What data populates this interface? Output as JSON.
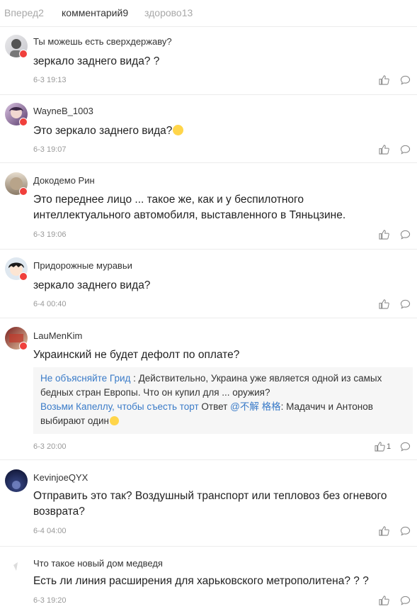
{
  "tabs": [
    {
      "label": "Вперед",
      "count": "2"
    },
    {
      "label": "комментарий",
      "count": "9"
    },
    {
      "label": "здорово",
      "count": "13"
    }
  ],
  "comments": [
    {
      "username": "Ты можешь есть сверхдержаву?",
      "text": "зеркало заднего вида? ?",
      "time": "6-3 19:13",
      "likes": ""
    },
    {
      "username": "WayneB_1003",
      "text": "Это зеркало заднего вида?",
      "time": "6-3 19:07",
      "likes": ""
    },
    {
      "username": "Докодемо Рин",
      "text_line1": "Это переднее лицо ... такое же, как и у беспилотного",
      "text_line2": "интеллектуального автомобиля, выставленного в Тяньцзине.",
      "time": "6-3 19:06",
      "likes": ""
    },
    {
      "username": "Придорожные муравьи",
      "text": "зеркало заднего вида?",
      "time": "6-4 00:40",
      "likes": ""
    },
    {
      "username": "LauMenKim",
      "text": "Украинский не будет дефолт по оплате?",
      "time": "6-3 20:00",
      "likes": "1",
      "replies": {
        "r1_author": "Не объясняйте Грид",
        "r1_text_a": " : Действительно, Украина уже является одной из самых",
        "r1_text_b": "бедных стран Европы. Что он купил для ... оружия?",
        "r2_author": "Возьми Капеллу, чтобы съесть торт",
        "r2_mid": " Ответ ",
        "r2_mention": "@不解 格格",
        "r2_text_a": ": Мадачич и Антонов",
        "r2_text_b": "выбирают один"
      }
    },
    {
      "username": "KevinjoeQYX",
      "text_line1": "Отправить это так? Воздушный транспорт или тепловоз без огневого",
      "text_line2": "возврата?",
      "time": "6-4 04:00",
      "likes": ""
    },
    {
      "username": "Что такое новый дом медведя",
      "text": "Есть ли линия расширения для харьковского метрополитена? ? ?",
      "time": "6-3 19:20",
      "likes": ""
    }
  ],
  "colors": {
    "accent": "#3a7bc8",
    "badge": "#f0403c",
    "muted": "#999999"
  },
  "icons": [
    "like-icon",
    "reply-icon",
    "verified-badge-icon"
  ]
}
